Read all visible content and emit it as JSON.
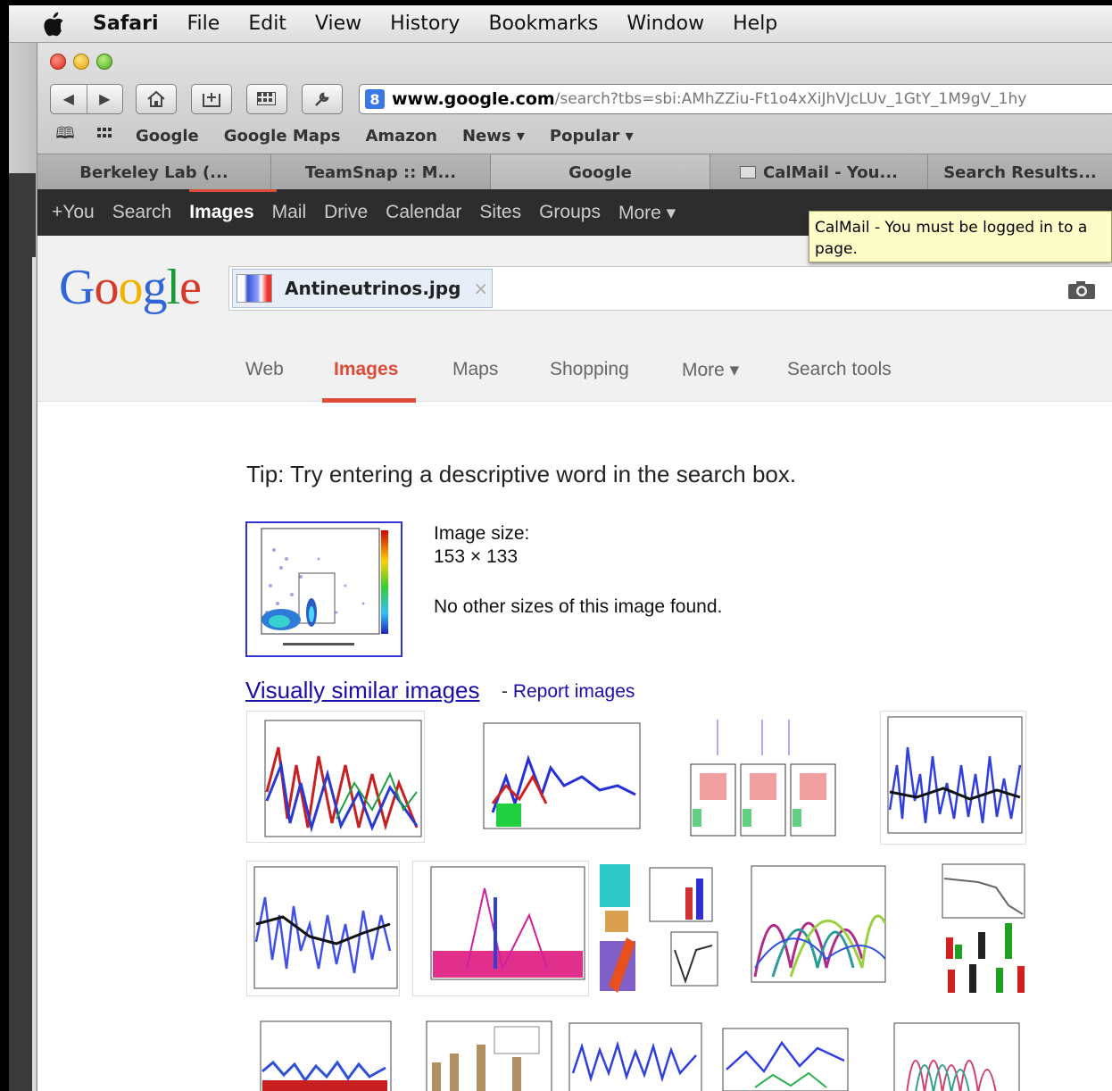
{
  "menubar": {
    "icon": "apple-icon",
    "items": [
      "Safari",
      "File",
      "Edit",
      "View",
      "History",
      "Bookmarks",
      "Window",
      "Help"
    ]
  },
  "toolbar": {
    "address_host": "www.google.com",
    "address_path": "/search?tbs=sbi:AMhZZiu-Ft1o4xXiJhVJcLUv_1GtY_1M9gV_1hy",
    "favicon_glyph": "8"
  },
  "bookmarks": [
    "Google",
    "Google Maps",
    "Amazon",
    "News ▾",
    "Popular ▾"
  ],
  "tabs": [
    "Berkeley Lab (...",
    "TeamSnap :: M...",
    "Google",
    "CalMail - You...",
    "Search Results..."
  ],
  "google_bar": [
    "+You",
    "Search",
    "Images",
    "Mail",
    "Drive",
    "Calendar",
    "Sites",
    "Groups",
    "More ▾"
  ],
  "tooltip": {
    "line1": "CalMail - You must be logged in to a",
    "line2": "page."
  },
  "logo": "Google",
  "search": {
    "chip_label": "Antineutrinos.jpg",
    "chip_close": "×"
  },
  "result_tabs": [
    "Web",
    "Images",
    "Maps",
    "Shopping",
    "More ▾",
    "Search tools"
  ],
  "content": {
    "tip": "Tip: Try entering a descriptive word in the search box.",
    "image_size_label": "Image size:",
    "image_size_value": "153 × 133",
    "no_other_sizes": "No other sizes of this image found.",
    "visually_similar": "Visually similar images",
    "dash": " - ",
    "report_images": "Report images"
  },
  "colors": {
    "google_red": "#dd4b39",
    "link_blue": "#1a0dab",
    "tooltip_bg": "#fdfdc8",
    "gbar_bg": "#2d2d2d"
  }
}
